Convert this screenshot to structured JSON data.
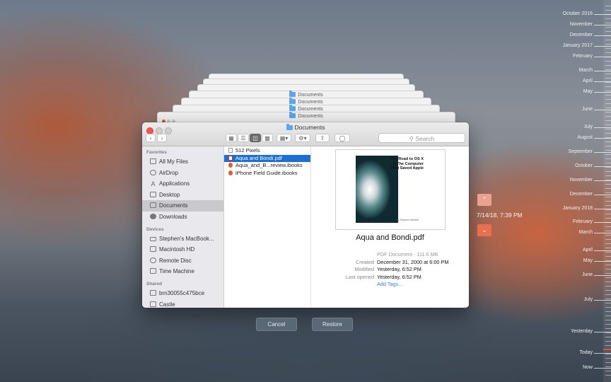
{
  "stack_title": "Documents",
  "window": {
    "title": "Documents",
    "search_placeholder": "Search"
  },
  "sidebar": {
    "favorites_heading": "Favorites",
    "favorites": [
      {
        "label": "All My Files",
        "icon": "all-files-icon"
      },
      {
        "label": "AirDrop",
        "icon": "airdrop-icon"
      },
      {
        "label": "Applications",
        "icon": "applications-icon"
      },
      {
        "label": "Desktop",
        "icon": "desktop-icon"
      },
      {
        "label": "Documents",
        "icon": "documents-icon",
        "selected": true
      },
      {
        "label": "Downloads",
        "icon": "downloads-icon"
      }
    ],
    "devices_heading": "Devices",
    "devices": [
      {
        "label": "Stephen's MacBook...",
        "icon": "laptop-icon"
      },
      {
        "label": "Macintosh HD",
        "icon": "hard-drive-icon"
      },
      {
        "label": "Remote Disc",
        "icon": "disc-icon"
      },
      {
        "label": "Time Machine",
        "icon": "time-machine-icon"
      }
    ],
    "shared_heading": "Shared",
    "shared": [
      {
        "label": "brn30055c475bce",
        "icon": "printer-icon"
      },
      {
        "label": "Castle",
        "icon": "network-icon"
      }
    ]
  },
  "files": [
    {
      "name": "512 Pixels",
      "type": "doc"
    },
    {
      "name": "Aqua and Bondi.pdf",
      "type": "pdf",
      "selected": true
    },
    {
      "name": "Aqua_and_B...review.ibooks",
      "type": "book"
    },
    {
      "name": "iPhone Field Guide.ibooks",
      "type": "book"
    }
  ],
  "preview": {
    "cover_title": "The Road to OS X & The Computer That Saved Apple",
    "cover_author": "by Stephen Hackett",
    "name": "Aqua and Bondi.pdf",
    "kind": "PDF Document - 111.6 MB",
    "created_label": "Created",
    "created": "December 31, 2000 at 6:00 PM",
    "modified_label": "Modified",
    "modified": "Yesterday, 6:52 PM",
    "last_opened_label": "Last opened",
    "last_opened": "Yesterday, 6:52 PM",
    "add_tags": "Add Tags..."
  },
  "buttons": {
    "cancel": "Cancel",
    "restore": "Restore"
  },
  "snapshot_time": "7/14/18, 7:39 PM",
  "timeline": [
    "October 2016",
    "November",
    "December",
    "January 2017",
    "February",
    "March",
    "April",
    "May",
    "June",
    "July",
    "August",
    "September",
    "October",
    "November",
    "December",
    "January 2018",
    "February",
    "March",
    "April",
    "May",
    "June",
    "July",
    "Yesterday",
    "Today",
    "Now"
  ],
  "colors": {
    "accent": "#1b6fd6",
    "timeline_marker": "#ea4c3a",
    "arrow": "#ea6f4f"
  }
}
